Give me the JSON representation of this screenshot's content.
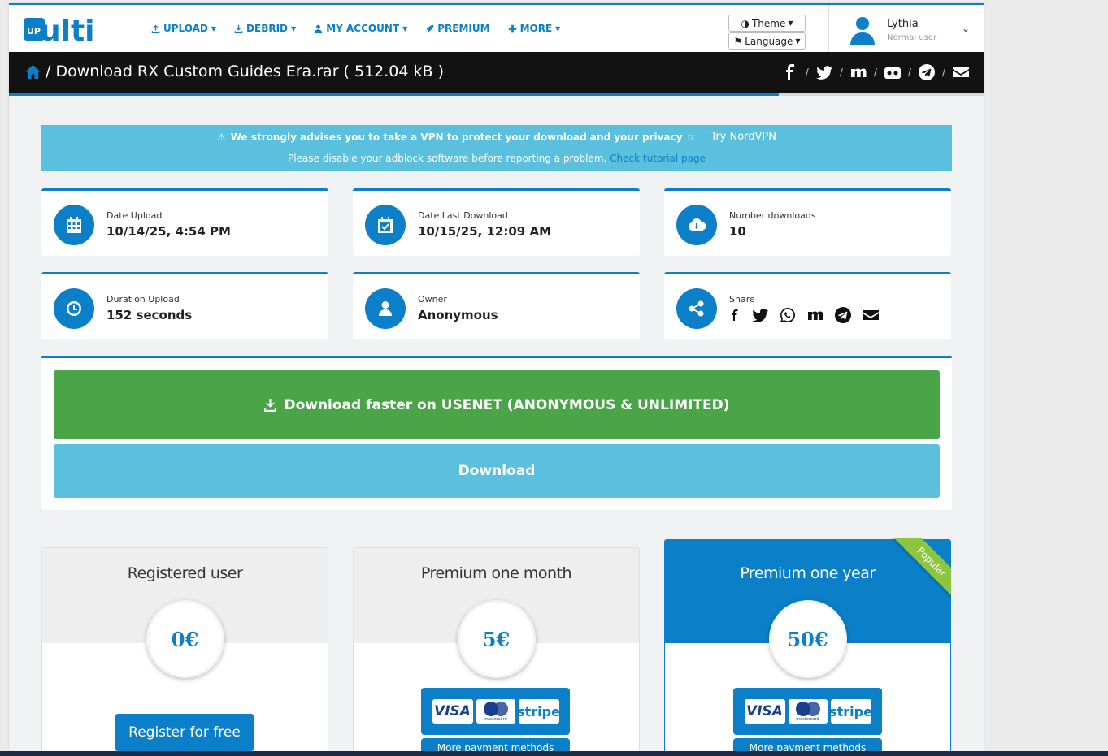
{
  "brand": {
    "logo_text": "Multi",
    "logo_badge": "UP"
  },
  "nav": {
    "items": [
      {
        "label": "UPLOAD",
        "icon": "upload-icon"
      },
      {
        "label": "DEBRID",
        "icon": "download-icon"
      },
      {
        "label": "MY ACCOUNT",
        "icon": "user-icon"
      },
      {
        "label": "PREMIUM",
        "icon": "rocket-icon"
      },
      {
        "label": "MORE",
        "icon": "plus-icon"
      }
    ],
    "theme_label": "Theme",
    "language_label": "Language"
  },
  "user": {
    "name": "Lythia",
    "role": "Normal user"
  },
  "titlebar": {
    "title": "/ Download RX Custom Guides Era.rar ( 512.04 kB )",
    "progress": 0.79
  },
  "alert": {
    "vpn_text": "We strongly advises you to take a VPN to protect your download and your privacy",
    "vpn_link": "Try NordVPN",
    "adblock_text": "Please disable your adblock software before reporting a problem.",
    "tutorial_link": "Check tutorial page"
  },
  "info": {
    "date_upload": {
      "label": "Date Upload",
      "value": "10/14/25, 4:54 PM"
    },
    "date_last_download": {
      "label": "Date Last Download",
      "value": "10/15/25, 12:09 AM"
    },
    "number_downloads": {
      "label": "Number downloads",
      "value": "10"
    },
    "duration_upload": {
      "label": "Duration Upload",
      "value": "152 seconds"
    },
    "owner": {
      "label": "Owner",
      "value": "Anonymous"
    },
    "share": {
      "label": "Share"
    }
  },
  "download": {
    "usenet_label": "Download faster on USENET (ANONYMOUS & UNLIMITED)",
    "download_label": "Download"
  },
  "plans": [
    {
      "title": "Registered user",
      "price": "0€",
      "cta": "Register for free"
    },
    {
      "title": "Premium one month",
      "price": "5€",
      "more": "More payment methods"
    },
    {
      "title": "Premium one year",
      "price": "50€",
      "badge": "Popular",
      "more": "More payment methods"
    }
  ],
  "payment": {
    "visa": "VISA",
    "mastercard": "mastercard",
    "stripe": "stripe"
  },
  "colors": {
    "accent": "#0b7fc7",
    "green": "#4aa548",
    "info": "#5bc0de",
    "ribbon": "#8cc63f"
  }
}
